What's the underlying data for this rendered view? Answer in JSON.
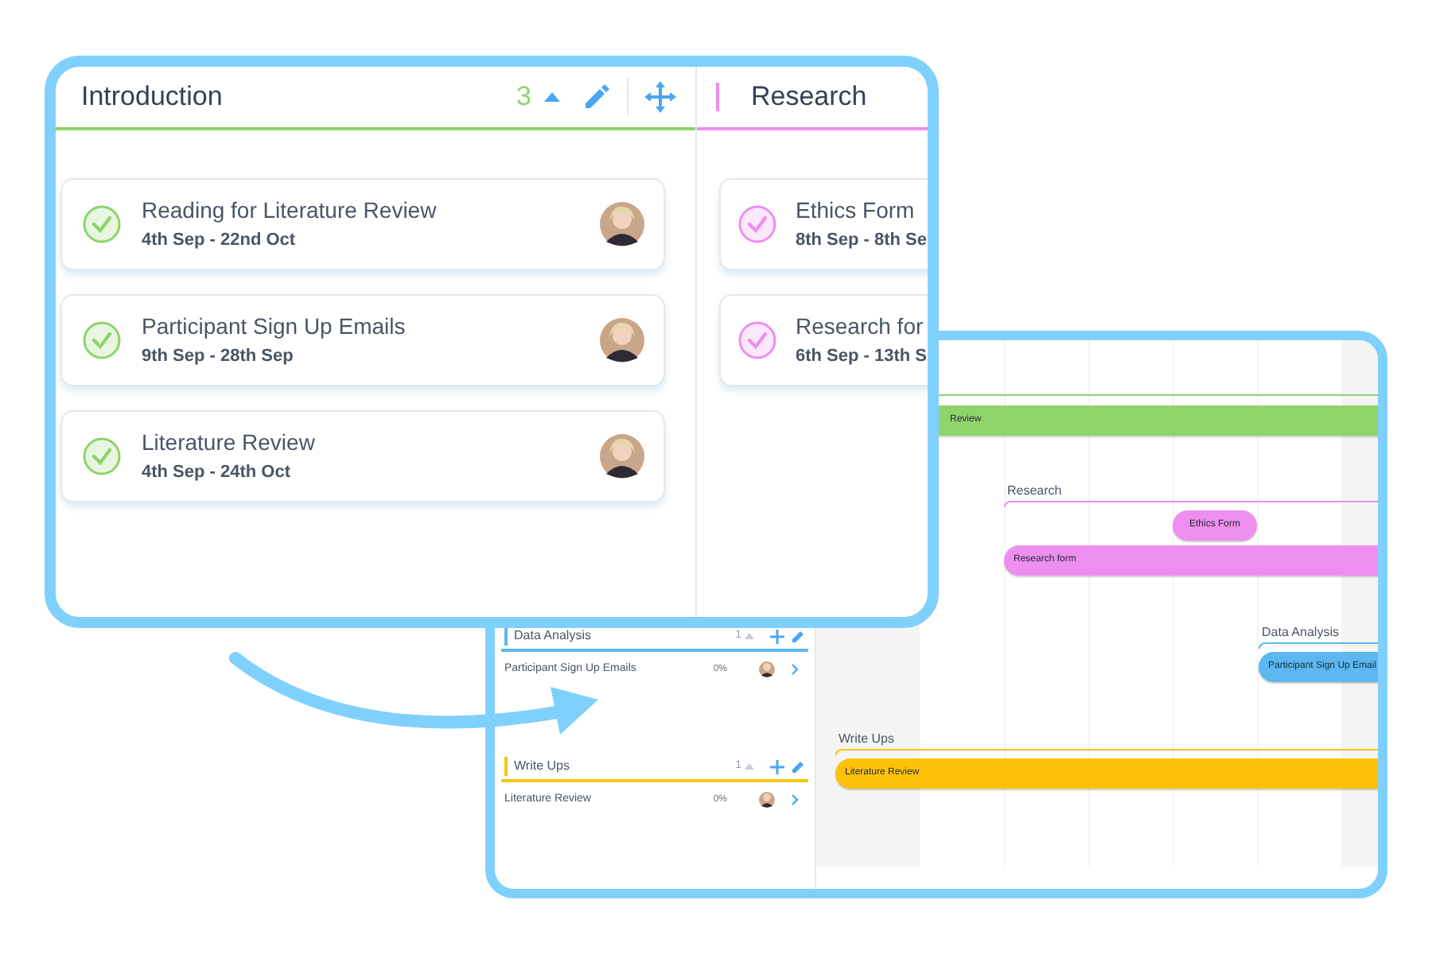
{
  "board": {
    "columns": [
      {
        "title": "Introduction",
        "color": "#8ed46a",
        "count": "3",
        "cards": [
          {
            "title": "Reading for Literature Review",
            "dates": "4th Sep - 22nd Oct"
          },
          {
            "title": "Participant Sign Up Emails",
            "dates": "9th Sep - 28th Sep"
          },
          {
            "title": "Literature Review",
            "dates": "4th Sep - 24th Oct"
          }
        ]
      },
      {
        "title": "Research",
        "color": "#ee8eee",
        "cards": [
          {
            "title": "Ethics Form",
            "dates": "8th Sep - 8th Se"
          },
          {
            "title": "Research for",
            "dates": "6th Sep - 13th S"
          }
        ]
      }
    ]
  },
  "list": {
    "groups": [
      {
        "title": "Data Analysis",
        "color": "#5bb8f0",
        "count": "1",
        "rows": [
          {
            "title": "Participant Sign Up Emails",
            "percent": "0%"
          }
        ]
      },
      {
        "title": "Write Ups",
        "color": "#f5c518",
        "count": "1",
        "rows": [
          {
            "title": "Literature Review",
            "percent": "0%"
          }
        ]
      }
    ]
  },
  "gantt": {
    "groups": [
      {
        "color": "#8ed46a",
        "bars": [
          {
            "label": "Review"
          }
        ]
      },
      {
        "label": "Research",
        "color": "#ee8eee",
        "bars": [
          {
            "label": "Ethics Form"
          },
          {
            "label": "Research form"
          }
        ]
      },
      {
        "label": "Data Analysis",
        "color": "#5bb8f0",
        "bars": [
          {
            "label": "Participant Sign Up Email"
          }
        ]
      },
      {
        "label": "Write Ups",
        "color": "#fcc20a",
        "bars": [
          {
            "label": "Literature Review"
          }
        ]
      }
    ]
  }
}
